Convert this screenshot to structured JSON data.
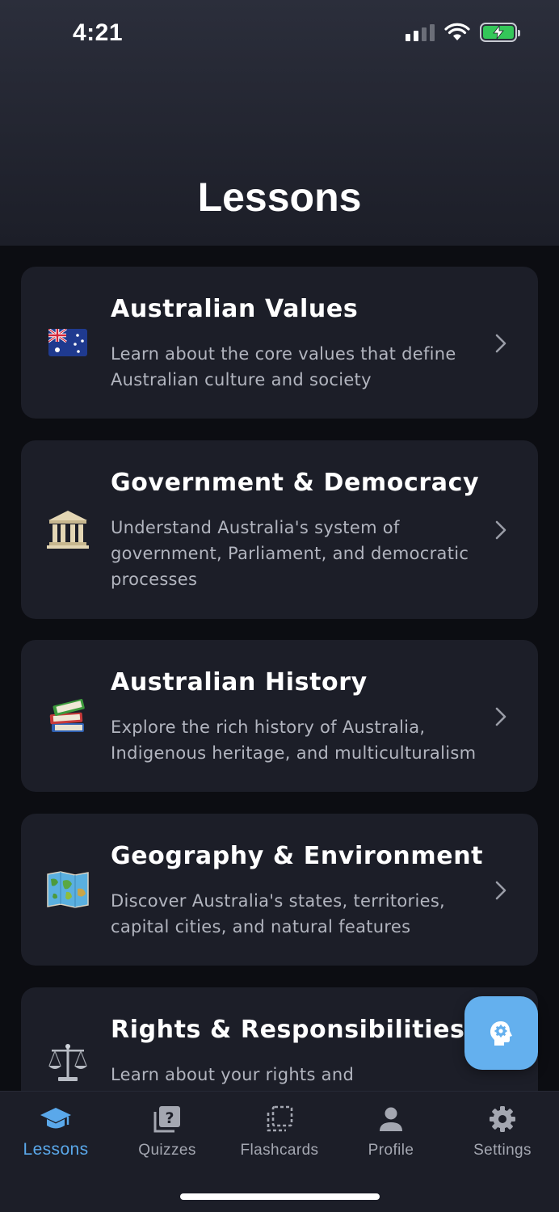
{
  "status_bar": {
    "time": "4:21"
  },
  "header": {
    "title": "Lessons"
  },
  "lessons": [
    {
      "icon": "australian-flag-icon",
      "title": "Australian Values",
      "description": "Learn about the core values that define Australian culture and society"
    },
    {
      "icon": "classical-building-icon",
      "title": "Government & Democracy",
      "description": "Understand Australia's system of government, Parliament, and democratic processes"
    },
    {
      "icon": "books-icon",
      "title": "Australian History",
      "description": "Explore the rich history of Australia, Indigenous heritage, and multiculturalism"
    },
    {
      "icon": "world-map-icon",
      "title": "Geography & Environment",
      "description": "Discover Australia's states, territories, capital cities, and natural features"
    },
    {
      "icon": "balance-scale-icon",
      "title": "Rights & Responsibilities",
      "description": "Learn about your rights and"
    }
  ],
  "fab": {
    "icon": "head-gear-icon"
  },
  "tabs": [
    {
      "label": "Lessons",
      "icon": "graduation-cap-icon",
      "active": true
    },
    {
      "label": "Quizzes",
      "icon": "quiz-icon",
      "active": false
    },
    {
      "label": "Flashcards",
      "icon": "flashcards-icon",
      "active": false
    },
    {
      "label": "Profile",
      "icon": "person-icon",
      "active": false
    },
    {
      "label": "Settings",
      "icon": "gear-icon",
      "active": false
    }
  ],
  "colors": {
    "accent": "#5aa8ea",
    "fab": "#64b0ee",
    "card": "#1c1e28",
    "background": "#0c0d12"
  }
}
